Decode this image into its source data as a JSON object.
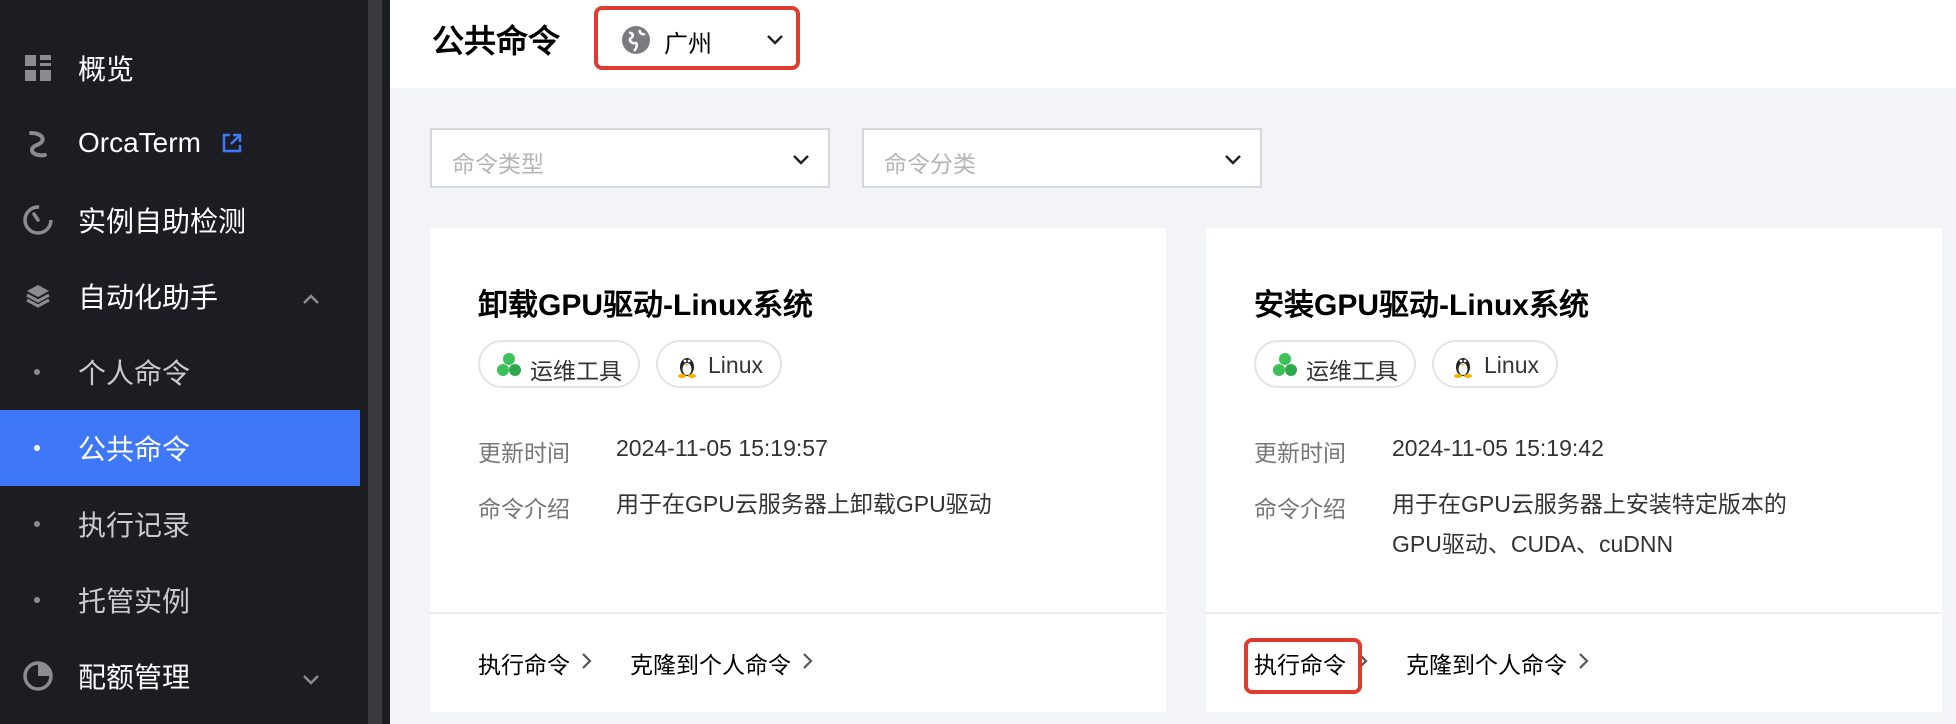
{
  "sidebar": {
    "items": [
      {
        "label": "概览",
        "icon": "dashboard-grid-icon"
      },
      {
        "label": "OrcaTerm",
        "icon": "orcaterm-icon",
        "external_icon": "external-link-icon"
      },
      {
        "label": "实例自助检测",
        "icon": "self-check-icon"
      },
      {
        "label": "自动化助手",
        "icon": "automation-icon",
        "expanded": true
      },
      {
        "label": "个人命令"
      },
      {
        "label": "公共命令",
        "active": true
      },
      {
        "label": "执行记录"
      },
      {
        "label": "托管实例"
      },
      {
        "label": "配额管理",
        "icon": "quota-pie-icon",
        "expanded": false
      }
    ]
  },
  "header": {
    "title": "公共命令",
    "region": {
      "value": "广州",
      "icon": "globe-icon"
    }
  },
  "filters": {
    "command_type": {
      "placeholder": "命令类型"
    },
    "command_category": {
      "placeholder": "命令分类"
    }
  },
  "cards": [
    {
      "title": "卸载GPU驱动-Linux系统",
      "tags": [
        {
          "label": "运维工具",
          "icon": "ops-tools-icon"
        },
        {
          "label": "Linux",
          "icon": "linux-penguin-icon"
        }
      ],
      "updated_label": "更新时间",
      "updated_value": "2024-11-05 15:19:57",
      "desc_label": "命令介绍",
      "desc_lines": [
        "用于在GPU云服务器上卸载GPU驱动"
      ],
      "run_label": "执行命令",
      "clone_label": "克隆到个人命令"
    },
    {
      "title": "安装GPU驱动-Linux系统",
      "tags": [
        {
          "label": "运维工具",
          "icon": "ops-tools-icon"
        },
        {
          "label": "Linux",
          "icon": "linux-penguin-icon"
        }
      ],
      "updated_label": "更新时间",
      "updated_value": "2024-11-05 15:19:42",
      "desc_label": "命令介绍",
      "desc_lines": [
        "用于在GPU云服务器上安装特定版本的",
        "GPU驱动、CUDA、cuDNN"
      ],
      "run_label": "执行命令",
      "clone_label": "克隆到个人命令"
    }
  ],
  "colors": {
    "sidebar_bg": "#1c1d22",
    "active_bg": "#3f78f6",
    "highlight": "#e13a2f",
    "tag_green": "#3cc15a"
  }
}
